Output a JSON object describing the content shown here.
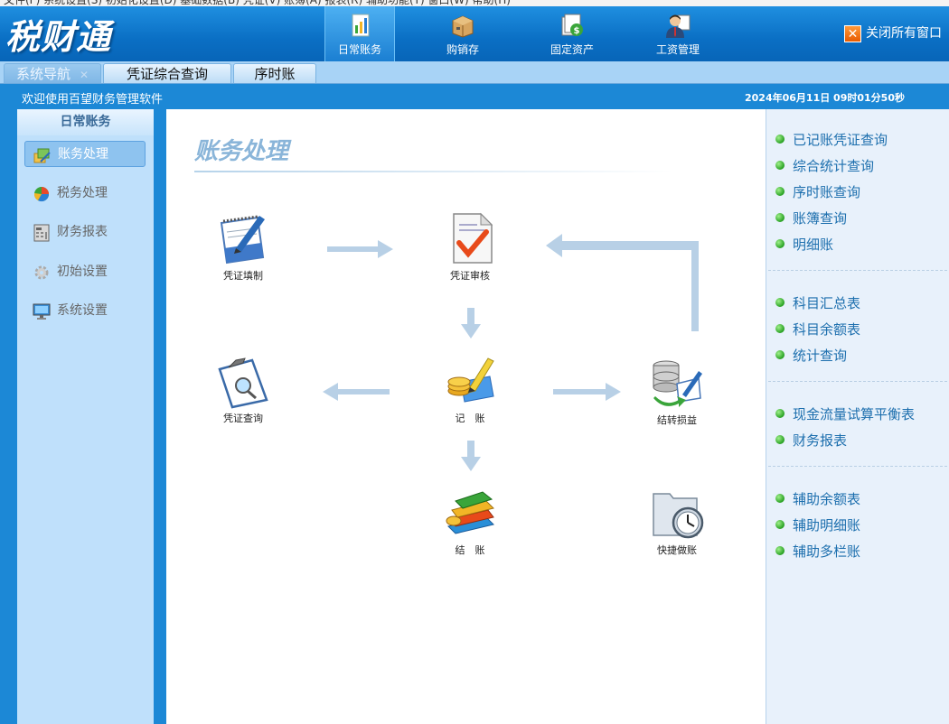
{
  "app": {
    "logo": "税财通",
    "menu_text": "文件(F)  系统设置(S)  初始化设置(D)  基础数据(B)  凭证(V)  账簿(A)  报表(R)  辅助功能(T)  窗口(W)  帮助(H)"
  },
  "header": {
    "modules": [
      {
        "label": "日常账务",
        "icon": "ledger-book-icon"
      },
      {
        "label": "购销存",
        "icon": "package-box-icon"
      },
      {
        "label": "固定资产",
        "icon": "asset-register-icon"
      },
      {
        "label": "工资管理",
        "icon": "employee-person-icon"
      }
    ],
    "close_all": "关闭所有窗口"
  },
  "tabs": [
    {
      "label": "系统导航"
    },
    {
      "label": "凭证综合查询"
    },
    {
      "label": "序时账"
    }
  ],
  "welcome_bar": {
    "message": "欢迎使用百望财务管理软件",
    "datetime": "2024年06月11日  09时01分50秒"
  },
  "left_nav": {
    "title": "日常账务",
    "items": [
      {
        "label": "账务处理",
        "icon": "account-process-icon"
      },
      {
        "label": "税务处理",
        "icon": "pie-chart-icon"
      },
      {
        "label": "财务报表",
        "icon": "report-sheet-icon"
      },
      {
        "label": "初始设置",
        "icon": "gear-icon"
      },
      {
        "label": "系统设置",
        "icon": "monitor-icon"
      }
    ]
  },
  "main": {
    "title": "账务处理",
    "workflow": {
      "voucher_entry": "凭证填制",
      "voucher_review": "凭证审核",
      "voucher_query": "凭证查询",
      "posting": "记　账",
      "carry_forward": "结转损益",
      "closing": "结　账",
      "quick_booking": "快捷做账"
    }
  },
  "right_panel": {
    "group1": [
      "已记账凭证查询",
      "综合统计查询",
      "序时账查询",
      "账簿查询",
      "明细账"
    ],
    "group2": [
      "科目汇总表",
      "科目余额表",
      "统计查询"
    ],
    "group3": [
      "现金流量试算平衡表",
      "财务报表"
    ],
    "group4": [
      "辅助余额表",
      "辅助明细账",
      "辅助多栏账"
    ]
  },
  "colors": {
    "header_blue": "#0a6fc4",
    "tab_bar": "#a8d3f6",
    "nav_bg": "#bfe0fb",
    "link_blue": "#1d6fae",
    "arrow": "#b8d0e6",
    "status_green": "#27a022",
    "close_orange": "#e85a00"
  }
}
